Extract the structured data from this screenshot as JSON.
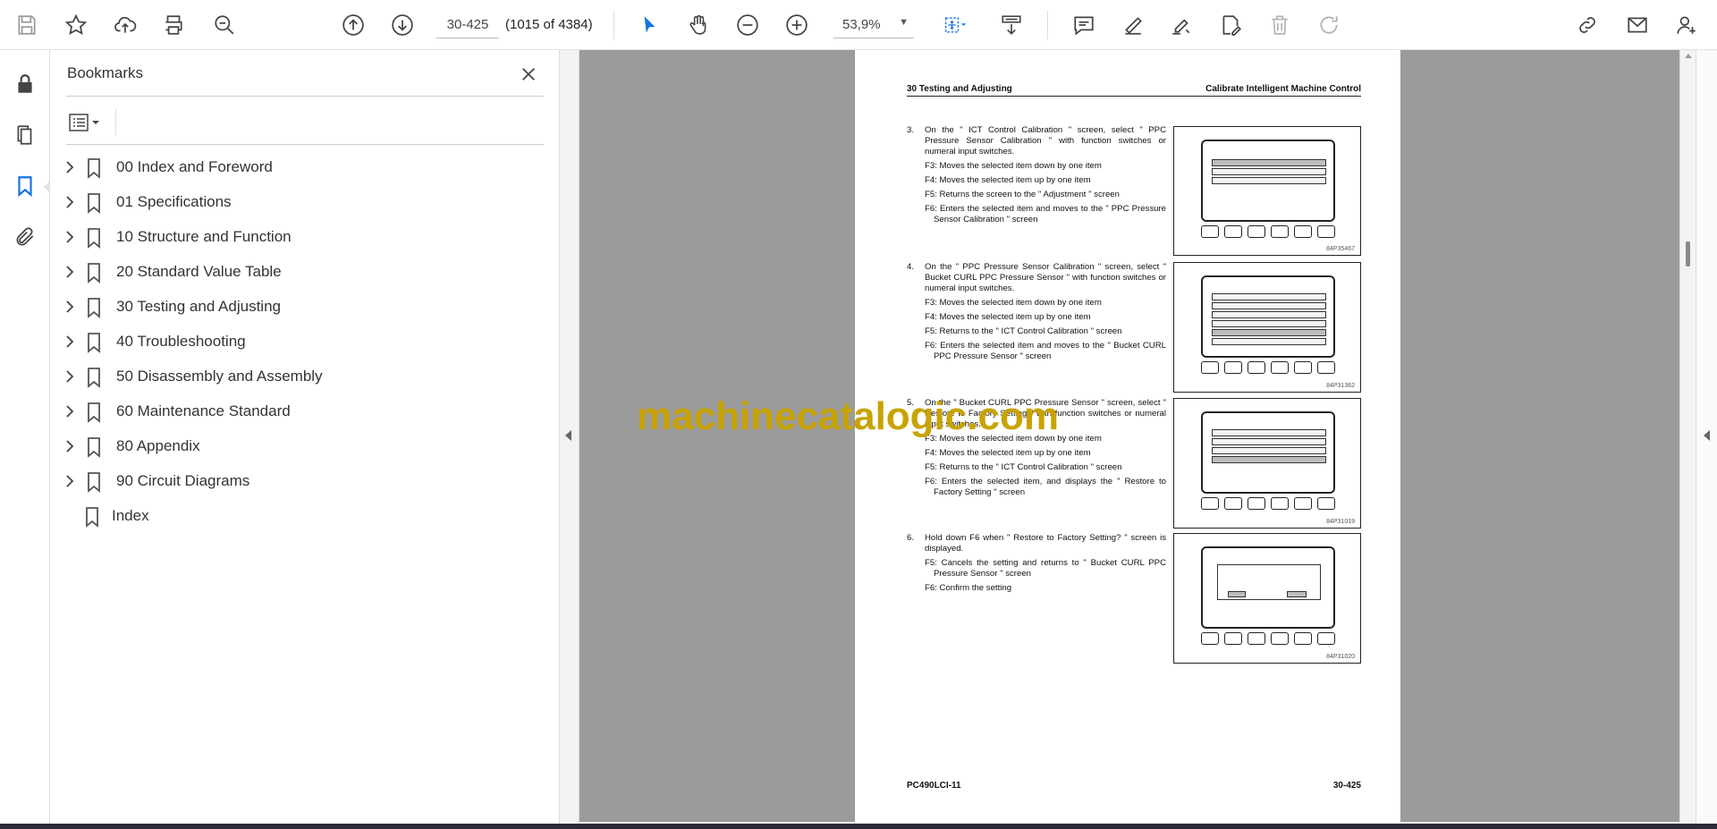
{
  "toolbar": {
    "page_value": "30-425",
    "page_count": "(1015 of 4384)",
    "zoom": "53,9%",
    "icons": [
      "save-icon",
      "bookmark-star-icon",
      "upload-icon",
      "print-icon",
      "search-zoom-icon",
      "page-up-icon",
      "page-down-icon",
      "zoom-out-icon",
      "zoom-in-icon",
      "select-arrow-icon",
      "hand-icon",
      "marquee-zoom-icon",
      "scrolling-mode-icon",
      "comment-icon",
      "highlight-icon",
      "sign-icon",
      "fill-sign-icon",
      "delete-icon",
      "redo-icon",
      "share-link-icon",
      "email-icon",
      "account-icon"
    ]
  },
  "rail": {
    "icons": [
      "lock-icon",
      "pages-icon",
      "bookmarks-icon",
      "attachment-icon"
    ]
  },
  "bookmarks": {
    "title": "Bookmarks",
    "items": [
      {
        "label": "00 Index and Foreword",
        "has_children": true
      },
      {
        "label": "01 Specifications",
        "has_children": true
      },
      {
        "label": "10 Structure and Function",
        "has_children": true
      },
      {
        "label": "20 Standard Value Table",
        "has_children": true
      },
      {
        "label": "30 Testing and Adjusting",
        "has_children": true
      },
      {
        "label": "40 Troubleshooting",
        "has_children": true
      },
      {
        "label": "50 Disassembly and Assembly",
        "has_children": true
      },
      {
        "label": "60 Maintenance Standard",
        "has_children": true
      },
      {
        "label": "80 Appendix",
        "has_children": true
      },
      {
        "label": "90 Circuit Diagrams",
        "has_children": true
      },
      {
        "label": "Index",
        "has_children": false
      }
    ]
  },
  "page": {
    "header_left": "30 Testing and Adjusting",
    "header_right": "Calibrate Intelligent Machine Control",
    "footer_left": "PC490LCI-11",
    "footer_right": "30-425",
    "steps": [
      {
        "num": "3.",
        "body": "On the \" ICT Control Calibration \" screen, select \" PPC Pressure Sensor Calibration \" with function switches or numeral input switches.",
        "lines": [
          "F3: Moves the selected item down by one item",
          "F4: Moves the selected item up by one item",
          "F5: Returns the screen to the \" Adjustment \" screen",
          "F6: Enters the selected item and moves to the \" PPC Pressure Sensor Calibration \" screen"
        ],
        "figure_caption": "84P35467"
      },
      {
        "num": "4.",
        "body": "On the \" PPC Pressure Sensor Calibration \" screen, select \" Bucket CURL PPC Pressure Sensor \" with function switches or numeral input switches.",
        "lines": [
          "F3: Moves the selected item down by one item",
          "F4: Moves the selected item up by one item",
          "F5: Returns to the \" ICT Control Calibration \" screen",
          "F6: Enters the selected item and moves to the \" Bucket CURL PPC Pressure Sensor \" screen"
        ],
        "figure_caption": "84P31362"
      },
      {
        "num": "5.",
        "body": "On the \" Bucket CURL PPC Pressure Sensor \" screen, select \" Restore to Factory Setting \" with function switches or numeral input switches.",
        "lines": [
          "F3: Moves the selected item down by one item",
          "F4: Moves the selected item up by one item",
          "F5: Returns to the \" ICT Control Calibration \" screen",
          "F6: Enters the selected item, and displays the \" Restore to Factory Setting \" screen"
        ],
        "figure_caption": "84P31019"
      },
      {
        "num": "6.",
        "body": "Hold down F6 when \" Restore to Factory Setting? \" screen is displayed.",
        "lines": [
          "F5: Cancels the setting and returns to \" Bucket CURL PPC Pressure Sensor \" screen",
          "F6: Confirm the setting"
        ],
        "figure_caption": "84P31020"
      }
    ]
  },
  "watermark": "machinecatalogic.com",
  "colors": {
    "accent_blue": "#1473e6",
    "watermark": "#c8a300",
    "doc_background": "#9b9b9b"
  }
}
